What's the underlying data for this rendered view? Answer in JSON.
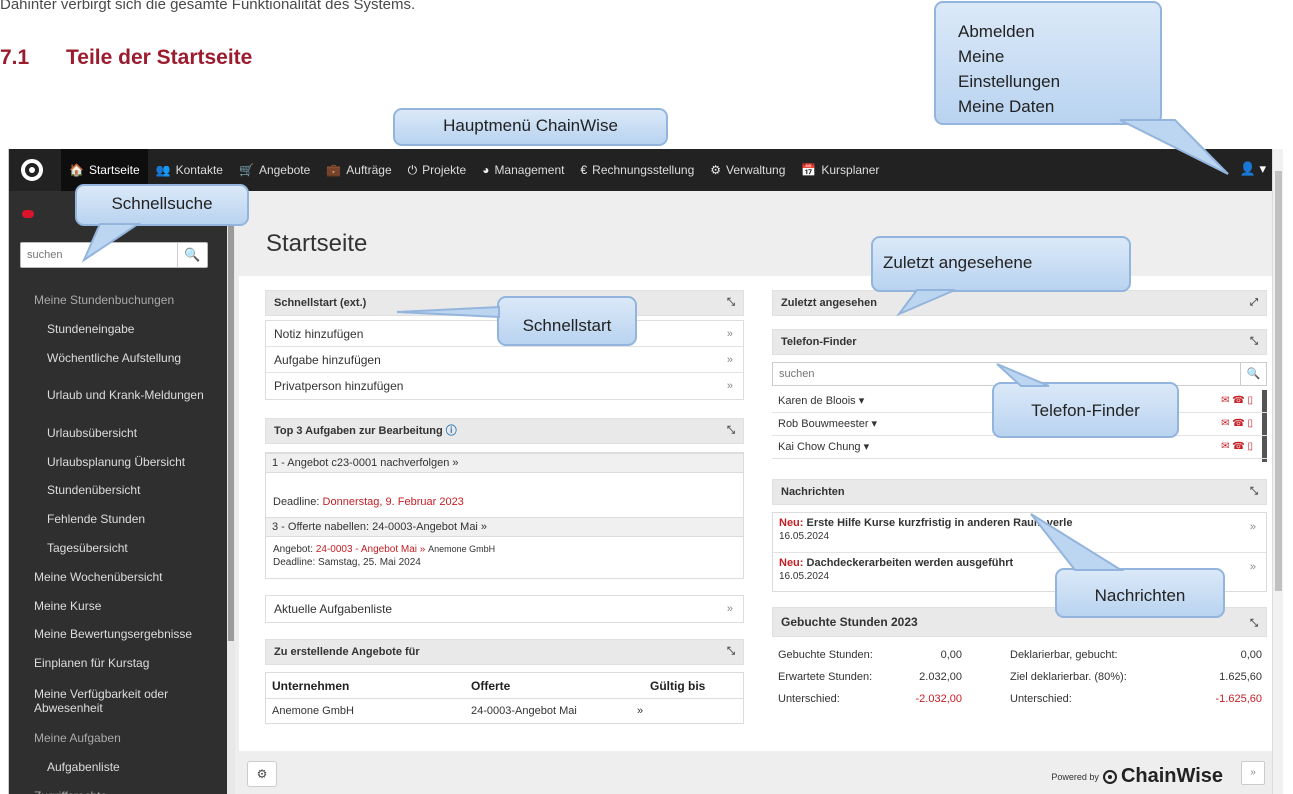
{
  "doc": {
    "intro": "Dahinter verbirgt sich die gesamte Funktionalität des Systems.",
    "section_num": "7.1",
    "section_title": "Teile der Startseite"
  },
  "topbar": {
    "nav": [
      {
        "icon": "home-icon",
        "glyph": "🏠",
        "label": "Startseite"
      },
      {
        "icon": "contacts-icon",
        "glyph": "👥",
        "label": "Kontakte"
      },
      {
        "icon": "cart-icon",
        "glyph": "🛒",
        "label": "Angebote"
      },
      {
        "icon": "briefcase-icon",
        "glyph": "💼",
        "label": "Aufträge"
      },
      {
        "icon": "power-icon",
        "glyph": "⏻",
        "label": "Projekte"
      },
      {
        "icon": "pie-chart-icon",
        "glyph": "◕",
        "label": "Management"
      },
      {
        "icon": "euro-icon",
        "glyph": "€",
        "label": "Rechnungsstellung"
      },
      {
        "icon": "cogs-icon",
        "glyph": "⚙",
        "label": "Verwaltung"
      },
      {
        "icon": "calendar-icon",
        "glyph": "📅",
        "label": "Kursplaner"
      }
    ],
    "user_icon": "👤 ▾"
  },
  "sidebar": {
    "search_placeholder": "suchen",
    "search_icon": "🔍",
    "items": [
      {
        "label": "Meine Stundenbuchungen",
        "sub": false,
        "dim": true
      },
      {
        "label": "Stundeneingabe",
        "sub": true
      },
      {
        "label": "Wöchentliche Aufstellung",
        "sub": true
      },
      {
        "label": "Urlaub und Krank-Meldungen",
        "sub": true,
        "tall": true
      },
      {
        "label": "Urlaubsübersicht",
        "sub": true
      },
      {
        "label": "Urlaubsplanung Übersicht",
        "sub": true
      },
      {
        "label": "Stundenübersicht",
        "sub": true
      },
      {
        "label": "Fehlende Stunden",
        "sub": true
      },
      {
        "label": "Tagesübersicht",
        "sub": true
      },
      {
        "label": "Meine Wochenübersicht",
        "sub": false
      },
      {
        "label": "Meine Kurse",
        "sub": false
      },
      {
        "label": "Meine Bewertungsergebnisse",
        "sub": false
      },
      {
        "label": "Einplanen für Kurstag",
        "sub": false
      },
      {
        "label": "Meine Verfügbarkeit oder Abwesenheit",
        "sub": false,
        "tall": true
      },
      {
        "label": "Meine Aufgaben",
        "sub": false,
        "dim": true
      },
      {
        "label": "Aufgabenliste",
        "sub": true
      },
      {
        "label": "Zugriffsrechte",
        "sub": false,
        "dim": true
      }
    ]
  },
  "main": {
    "title": "Startseite",
    "schnellstart": {
      "title": "Schnellstart (ext.)",
      "items": [
        "Notiz hinzufügen",
        "Aufgabe hinzufügen",
        "Privatperson hinzufügen"
      ]
    },
    "top3": {
      "title": "Top 3 Aufgaben zur Bearbeitung",
      "task1_head": "1 - Angebot c23-0001 nachverfolgen »",
      "task1_deadline_label": "Deadline:",
      "task1_deadline": "Donnerstag, 9. Februar 2023",
      "task3_head": "3 - Offerte nabellen: 24-0003-Angebot Mai  »",
      "task3_offer_label": "Angebot:",
      "task3_offer_link": "24-0003 - Angebot Mai »",
      "task3_company": "Anemone GmbH",
      "task3_deadline": "Deadline: Samstag, 25. Mai 2024"
    },
    "aufgabenliste": "Aktuelle Aufgabenliste",
    "angebote": {
      "title": "Zu erstellende Angebote für",
      "cols": [
        "Unternehmen",
        "Offerte",
        "Gültig bis"
      ],
      "rows": [
        {
          "company": "Anemone GmbH",
          "offer": "24-0003-Angebot Mai",
          "valid": "»"
        }
      ]
    },
    "zuletzt": {
      "title": "Zuletzt angesehen"
    },
    "telefon": {
      "title": "Telefon-Finder",
      "placeholder": "suchen",
      "people": [
        "Karen de Bloois ▾",
        "Rob Bouwmeester ▾",
        "Kai Chow Chung ▾"
      ],
      "icons": "✉ ☎ ▯"
    },
    "nachrichten": {
      "title": "Nachrichten",
      "items": [
        {
          "prefix": "Neu:",
          "text": "Erste Hilfe Kurse kurzfristig in anderen Raum verle",
          "date": "16.05.2024"
        },
        {
          "prefix": "Neu:",
          "text": "Dachdeckerarbeiten werden ausgeführt",
          "date": "16.05.2024"
        }
      ]
    },
    "stunden": {
      "title": "Gebuchte Stunden 2023",
      "rows": [
        {
          "l1": "Gebuchte Stunden:",
          "v1": "0,00",
          "l2": "Deklarierbar, gebucht:",
          "v2": "0,00",
          "red": false
        },
        {
          "l1": "Erwartete Stunden:",
          "v1": "2.032,00",
          "l2": "Ziel deklarierbar. (80%):",
          "v2": "1.625,60",
          "red": false
        },
        {
          "l1": "Unterschied:",
          "v1": "-2.032,00",
          "l2": "Unterschied:",
          "v2": "-1.625,60",
          "red": true
        }
      ]
    },
    "footer": {
      "powered": "Powered by",
      "brand": "ChainWise",
      "gear": "⚙",
      "expand": "»"
    }
  },
  "callouts": {
    "abmelden": [
      "Abmelden",
      "Meine",
      "Einstellungen",
      "Meine Daten"
    ],
    "hauptmenue": "Hauptmenü ChainWise",
    "schnellsuche": "Schnellsuche",
    "zuletzt": "Zuletzt angesehene",
    "schnellstart": "Schnellstart",
    "telefon": "Telefon-Finder",
    "nachrichten": "Nachrichten"
  }
}
